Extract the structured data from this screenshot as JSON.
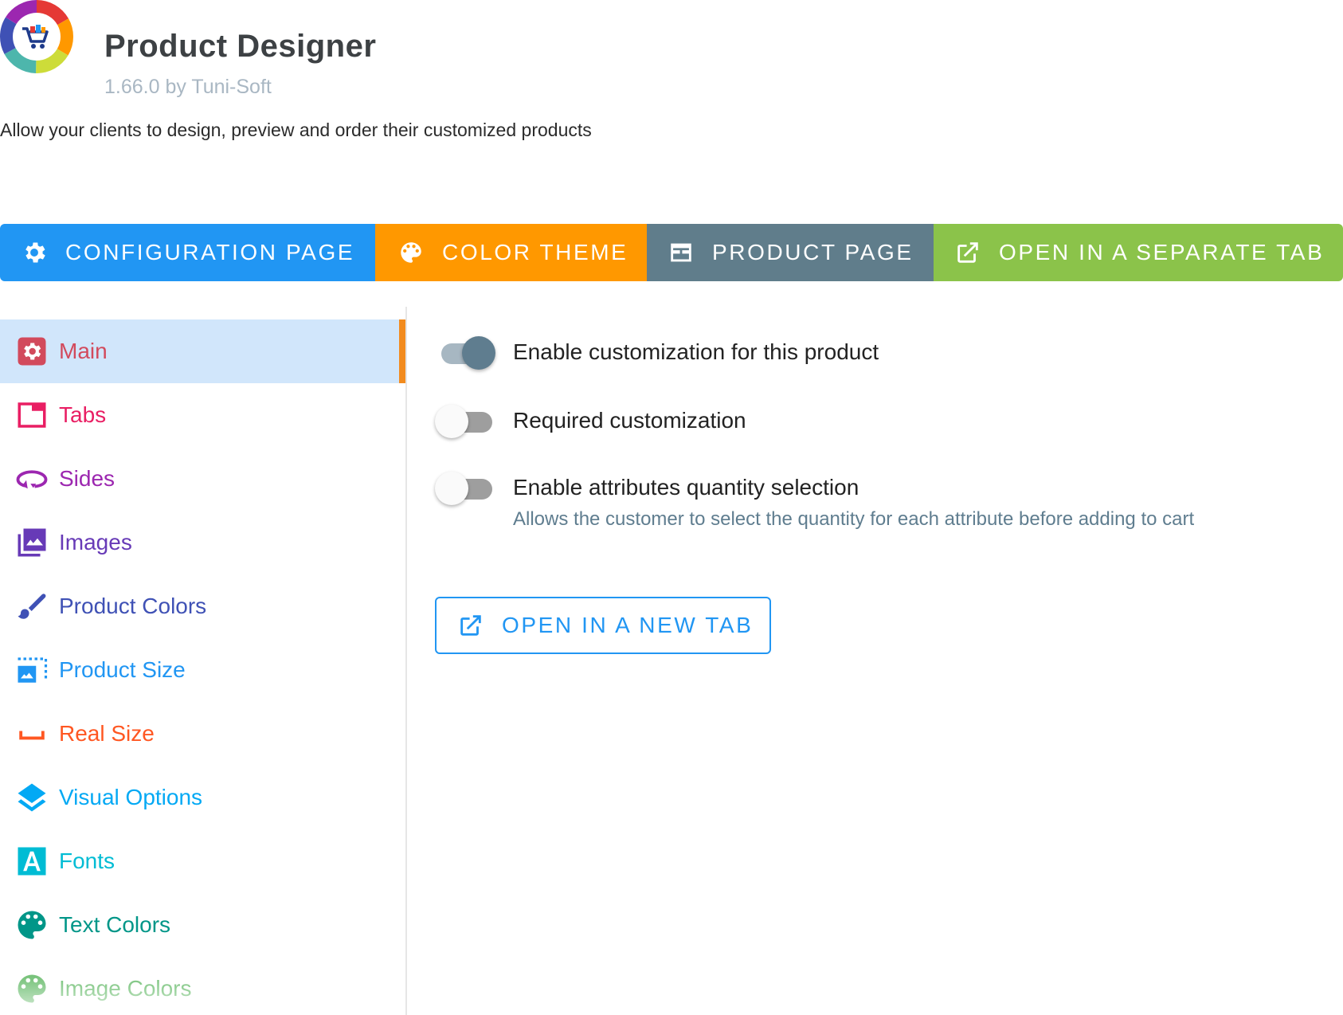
{
  "header": {
    "title": "Product Designer",
    "version": "1.66.0 by Tuni-Soft",
    "description": "Allow your clients to design, preview and order their customized products"
  },
  "toolbar": [
    {
      "label": "CONFIGURATION PAGE",
      "icon": "gear-icon",
      "color": "#2196f3"
    },
    {
      "label": "COLOR THEME",
      "icon": "palette-icon",
      "color": "#ff9800"
    },
    {
      "label": "PRODUCT PAGE",
      "icon": "web-page-icon",
      "color": "#607d8b"
    },
    {
      "label": "OPEN IN A SEPARATE TAB",
      "icon": "open-in-new-icon",
      "color": "#8bc34a"
    }
  ],
  "sidebar": {
    "items": [
      {
        "label": "Main",
        "icon": "gear-box-icon",
        "color": "#d24a5c",
        "active": true
      },
      {
        "label": "Tabs",
        "icon": "tab-icon",
        "color": "#e91e63"
      },
      {
        "label": "Sides",
        "icon": "rotate-3d-icon",
        "color": "#9c27b0"
      },
      {
        "label": "Images",
        "icon": "image-multiple-icon",
        "color": "#673ab7"
      },
      {
        "label": "Product Colors",
        "icon": "brush-icon",
        "color": "#3f51b5"
      },
      {
        "label": "Product Size",
        "icon": "image-size-icon",
        "color": "#2196f3"
      },
      {
        "label": "Real Size",
        "icon": "ruler-bracket-icon",
        "color": "#ff5722"
      },
      {
        "label": "Visual Options",
        "icon": "layers-icon",
        "color": "#03a9f4"
      },
      {
        "label": "Fonts",
        "icon": "font-icon",
        "color": "#00bcd4"
      },
      {
        "label": "Text Colors",
        "icon": "palette-icon",
        "color": "#009688"
      },
      {
        "label": "Image Colors",
        "icon": "palette-icon",
        "color": "#4caf50"
      }
    ]
  },
  "main": {
    "toggles": [
      {
        "label": "Enable customization for this product",
        "on": true,
        "help": ""
      },
      {
        "label": "Required customization",
        "on": false,
        "help": ""
      },
      {
        "label": "Enable attributes quantity selection",
        "on": false,
        "help": "Allows the customer to select the quantity for each attribute before adding to cart"
      }
    ],
    "open_button": {
      "label": "OPEN IN A NEW TAB",
      "icon": "open-in-new-icon"
    }
  }
}
